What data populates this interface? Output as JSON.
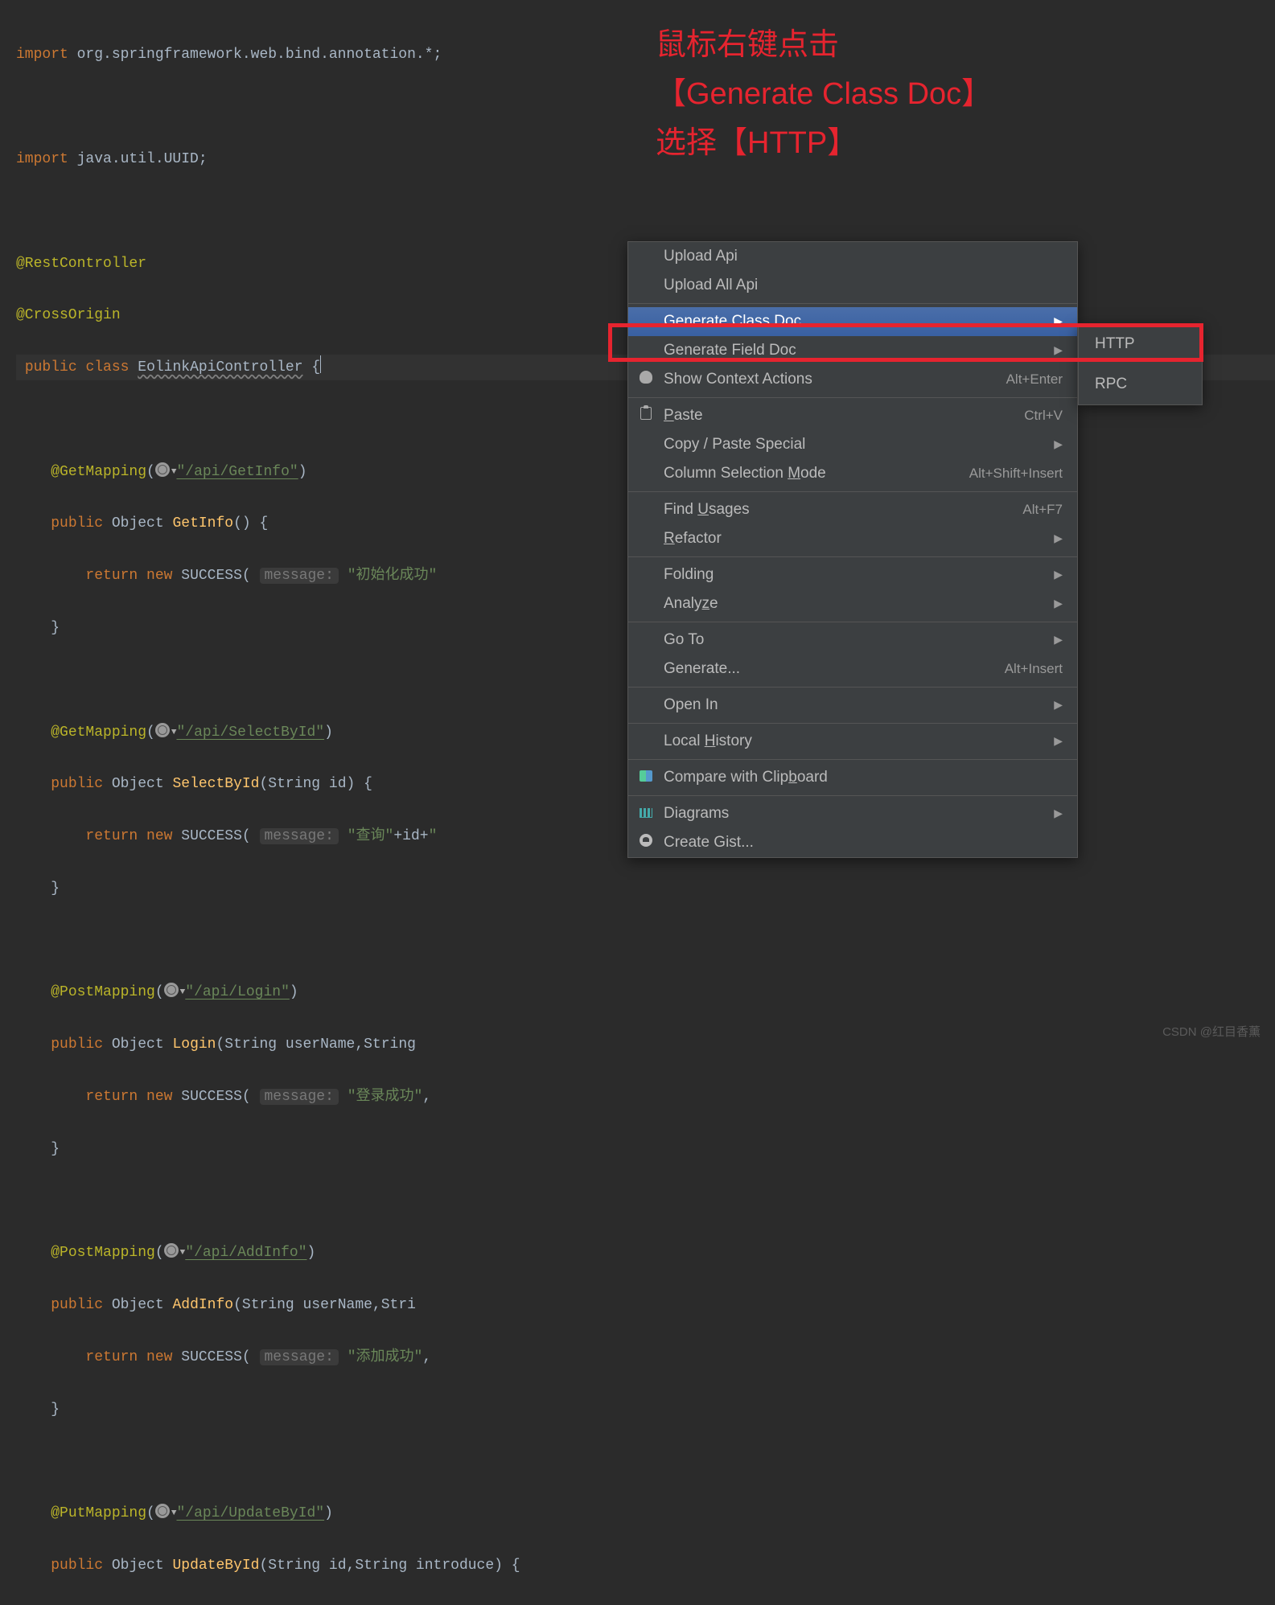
{
  "annotation": {
    "line1": "鼠标右键点击",
    "line2": "【Generate Class Doc】",
    "line3": "选择【HTTP】"
  },
  "code": {
    "import1_kw": "import",
    "import1_rest": " org.springframework.web.bind.annotation.*;",
    "import2_kw": "import",
    "import2_rest": " java.util.UUID;",
    "anno_rest": "@RestController",
    "anno_cross": "@CrossOrigin",
    "class_kw1": "public",
    "class_kw2": "class",
    "class_name": "EolinkApiController",
    "class_brace": "{",
    "getmap1": "@GetMapping",
    "getmap1_path": "\"/api/GetInfo\"",
    "m1_kw1": "public",
    "m1_ret": "Object",
    "m1_name": "GetInfo",
    "m1_params": "()",
    "m1_brace": "{",
    "ret_kw": "return",
    "new_kw": "new",
    "succ": "SUCCESS",
    "hint_msg": "message:",
    "m1_arg": "\"初始化成功\"",
    "getmap2": "@GetMapping",
    "getmap2_path": "\"/api/SelectById\"",
    "m2_name": "SelectById",
    "m2_params": "(String id)",
    "m2_arg_a": "\"查询\"",
    "m2_arg_b": "+id+",
    "m2_arg_c": "\"",
    "postmap1": "@PostMapping",
    "postmap1_path": "\"/api/Login\"",
    "m3_name": "Login",
    "m3_params": "(String userName,String",
    "m3_arg": "\"登录成功\"",
    "m3_comma": ",",
    "postmap2": "@PostMapping",
    "postmap2_path": "\"/api/AddInfo\"",
    "m4_name": "AddInfo",
    "m4_params": "(String userName,Stri",
    "m4_arg": "\"添加成功\"",
    "m4_comma": ",",
    "putmap": "@PutMapping",
    "putmap_path": "\"/api/UpdateById\"",
    "m5_name": "UpdateById",
    "m5_params": "(String id,String introduce) {",
    "close_brace": "}"
  },
  "menu": {
    "upload_api": "Upload Api",
    "upload_all": "Upload All Api",
    "gen_class": "Generate Class Doc",
    "gen_field": "Generate Field Doc",
    "show_ctx": "Show Context Actions",
    "show_ctx_sc": "Alt+Enter",
    "paste_pre": "",
    "paste_mn": "P",
    "paste_post": "aste",
    "paste_sc": "Ctrl+V",
    "copy_special": "Copy / Paste Special",
    "col_pre": "Column Selection ",
    "col_mn": "M",
    "col_post": "ode",
    "col_sc": "Alt+Shift+Insert",
    "find_pre": "Find ",
    "find_mn": "U",
    "find_post": "sages",
    "find_sc": "Alt+F7",
    "ref_mn": "R",
    "ref_post": "efactor",
    "folding": "Folding",
    "ana_pre": "Analy",
    "ana_mn": "z",
    "ana_post": "e",
    "goto": "Go To",
    "generate": "Generate...",
    "generate_sc": "Alt+Insert",
    "openin": "Open In",
    "lh_pre": "Local ",
    "lh_mn": "H",
    "lh_post": "istory",
    "cmp_pre": "Compare with Clip",
    "cmp_mn": "b",
    "cmp_post": "oard",
    "diagrams": "Diagrams",
    "gist": "Create Gist..."
  },
  "submenu": {
    "http": "HTTP",
    "rpc": "RPC"
  },
  "watermark": "CSDN @红目香薰"
}
